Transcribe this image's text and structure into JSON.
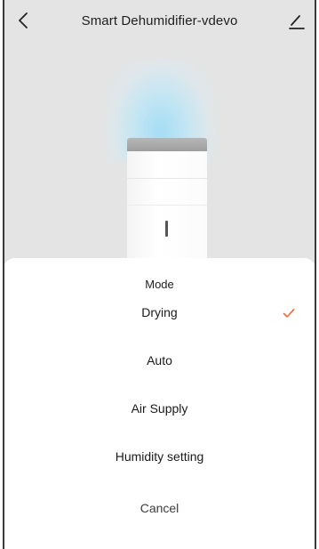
{
  "header": {
    "title": "Smart Dehumidifier-vdevo",
    "back_icon": "chevron-left-icon",
    "edit_icon": "pencil-icon"
  },
  "mode_sheet": {
    "title": "Mode",
    "options": [
      {
        "label": "Drying",
        "selected": true
      },
      {
        "label": "Auto",
        "selected": false
      },
      {
        "label": "Air Supply",
        "selected": false
      },
      {
        "label": "Humidity setting",
        "selected": false
      }
    ],
    "cancel_label": "Cancel",
    "check_color": "#f0693c"
  }
}
